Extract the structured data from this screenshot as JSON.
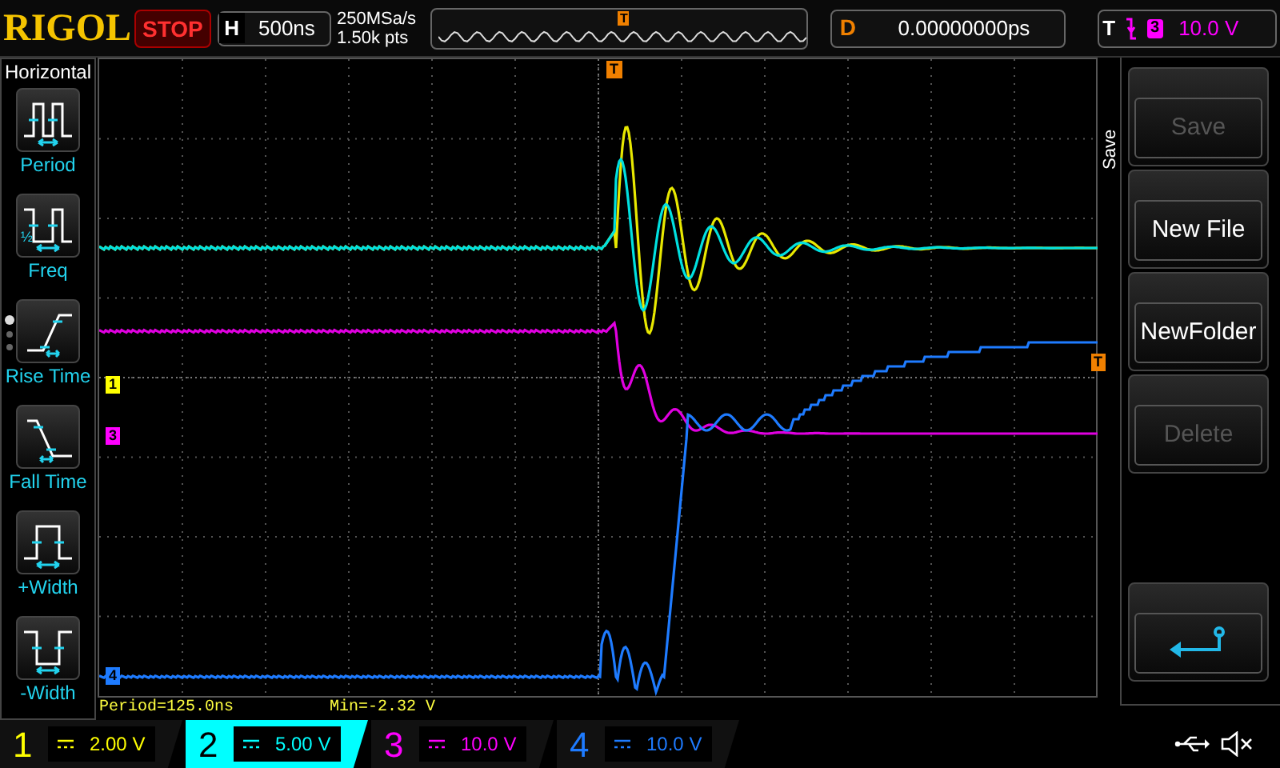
{
  "top_bar": {
    "brand": "RIGOL",
    "run_state": "STOP",
    "horizontal": {
      "label": "H",
      "timebase": "500ns"
    },
    "sample_rate": "250MSa/s",
    "memory": "1.50k pts",
    "trigger_position": "T",
    "delay": {
      "label": "D",
      "value": "0.00000000ps"
    },
    "trigger": {
      "label": "T",
      "source": "3",
      "level": "10.0 V"
    }
  },
  "left_menu": {
    "title": "Horizontal",
    "items": [
      {
        "kind": "period",
        "label": "Period"
      },
      {
        "kind": "freq",
        "label": "Freq",
        "half_label": "½"
      },
      {
        "kind": "rise",
        "label": "Rise Time"
      },
      {
        "kind": "fall",
        "label": "Fall Time"
      },
      {
        "kind": "pwidth",
        "label": "+Width"
      },
      {
        "kind": "nwidth",
        "label": "-Width"
      }
    ],
    "pages": [
      {
        "selected": true
      },
      {
        "selected": false
      },
      {
        "selected": false
      }
    ]
  },
  "screen": {
    "trigger_marker": "T",
    "right_marker": "T",
    "channel_markers": [
      {
        "label": "1",
        "color": "#ffff00"
      },
      {
        "label": "3",
        "color": "#ff00ff"
      },
      {
        "label": "4",
        "color": "#1e7bff"
      }
    ],
    "traces": [
      {
        "color": "#e8e800"
      },
      {
        "color": "#00e0e0"
      },
      {
        "color": "#e000e0"
      },
      {
        "color": "#1e7bff"
      }
    ],
    "measurements": [
      "Period=125.0ns",
      "Min=-2.32 V"
    ]
  },
  "right_menu": {
    "title": "Save",
    "buttons": [
      {
        "kind": "text",
        "label": "Save",
        "disabled": true
      },
      {
        "kind": "text",
        "label": "New File",
        "disabled": false
      },
      {
        "kind": "text",
        "label": "NewFolder",
        "disabled": false
      },
      {
        "kind": "text",
        "label": "Delete",
        "disabled": true
      },
      {
        "kind": "return"
      }
    ]
  },
  "channels": [
    {
      "number": "1",
      "scale": "2.00 V",
      "color": "#ffff00",
      "selected": false
    },
    {
      "number": "2",
      "scale": "5.00 V",
      "color": "#00ffff",
      "selected": true
    },
    {
      "number": "3",
      "scale": "10.0 V",
      "color": "#ff00ff",
      "selected": false
    },
    {
      "number": "4",
      "scale": "10.0 V",
      "color": "#1e7bff",
      "selected": false
    }
  ]
}
